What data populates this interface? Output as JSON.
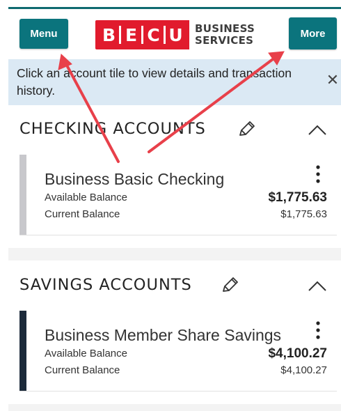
{
  "header": {
    "menu_label": "Menu",
    "more_label": "More",
    "logo": {
      "letters": [
        "B",
        "E",
        "C",
        "U"
      ],
      "sub_line1": "BUSINESS",
      "sub_line2": "SERVICES"
    }
  },
  "banner": {
    "text": "Click an account tile to view details and transaction history.",
    "close_icon": "close-icon"
  },
  "sections": [
    {
      "title": "CHECKING ACCOUNTS",
      "accent": "#c8c8cc",
      "account": {
        "name": "Business Basic Checking",
        "available_label": "Available Balance",
        "available_value": "$1,775.63",
        "current_label": "Current Balance",
        "current_value": "$1,775.63"
      }
    },
    {
      "title": "SAVINGS ACCOUNTS",
      "accent": "#1c2a3a",
      "account": {
        "name": "Business Member Share Savings",
        "available_label": "Available Balance",
        "available_value": "$4,100.27",
        "current_label": "Current Balance",
        "current_value": "$4,100.27"
      }
    }
  ],
  "colors": {
    "teal": "#0b747d",
    "brand_red": "#e11b2d",
    "banner_bg": "#dbe9f4",
    "annotation_arrow": "#e8404a"
  }
}
